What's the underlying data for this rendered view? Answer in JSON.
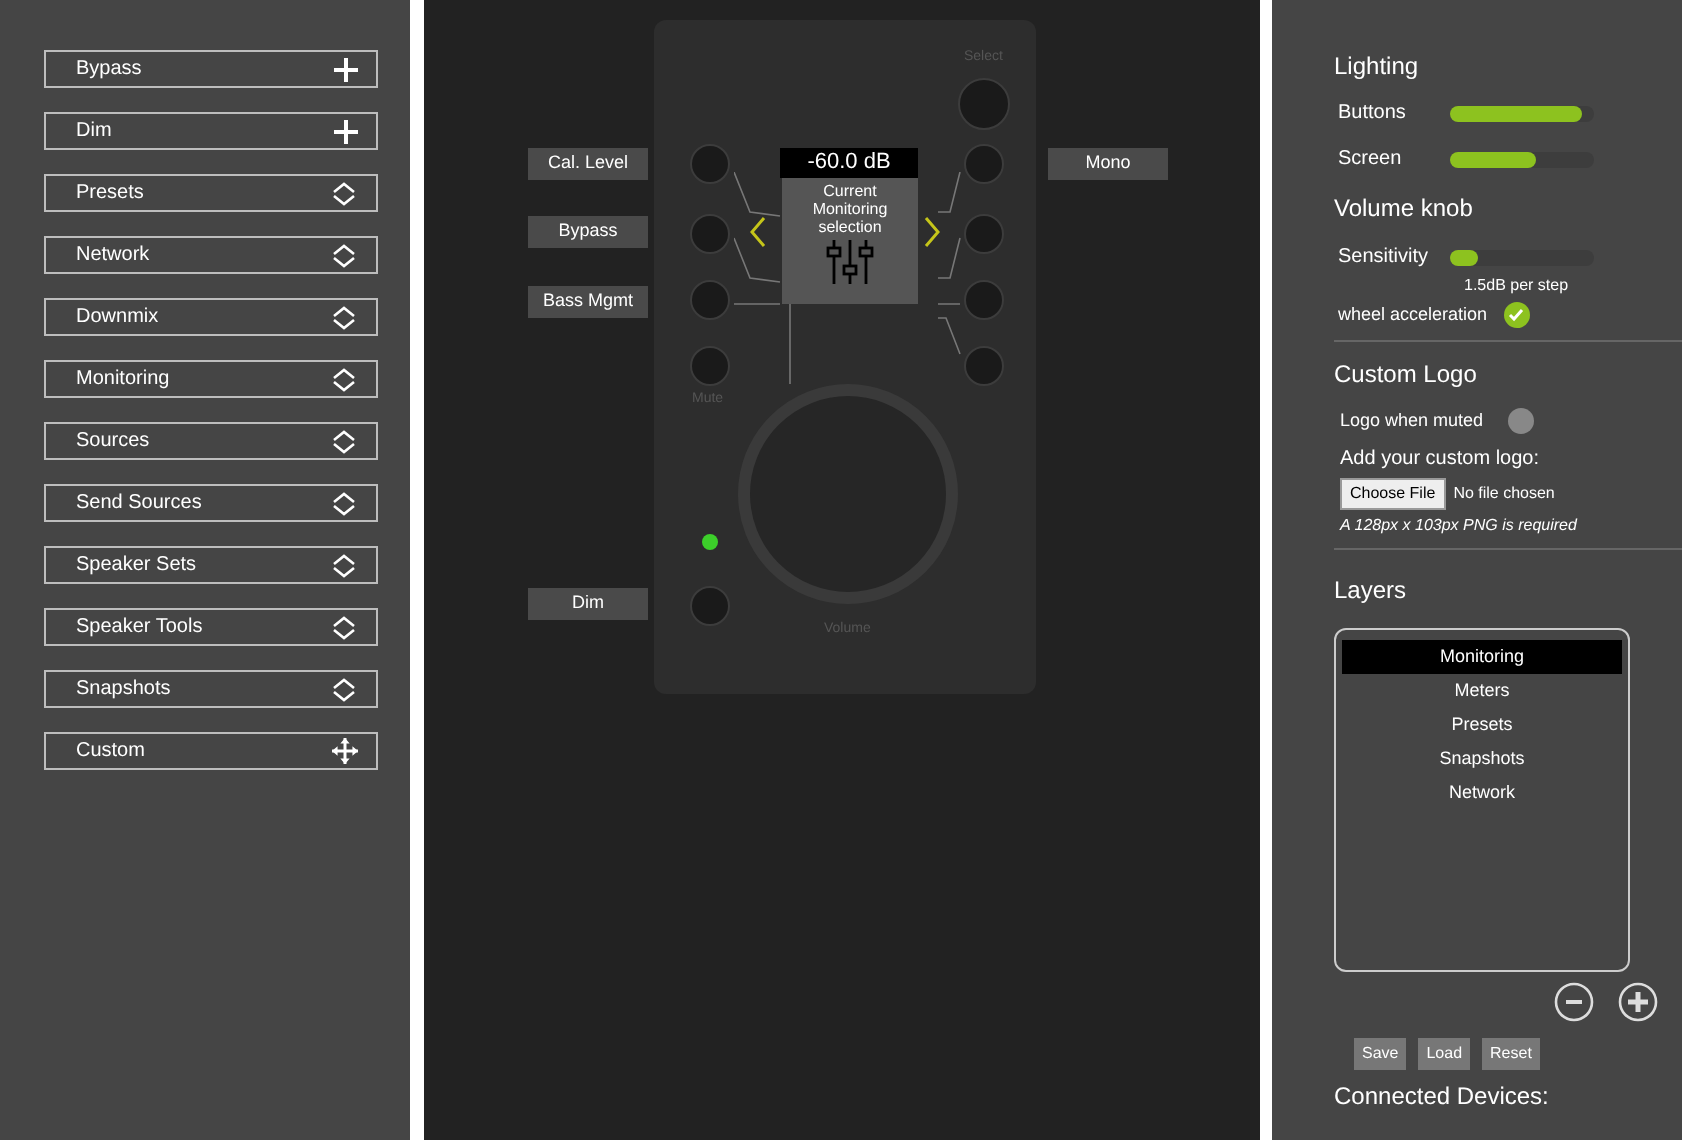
{
  "sidebar": {
    "items": [
      {
        "label": "Bypass",
        "kind": "add"
      },
      {
        "label": "Dim",
        "kind": "add"
      },
      {
        "label": "Presets",
        "kind": "expand"
      },
      {
        "label": "Network",
        "kind": "expand"
      },
      {
        "label": "Downmix",
        "kind": "expand"
      },
      {
        "label": "Monitoring",
        "kind": "expand"
      },
      {
        "label": "Sources",
        "kind": "expand"
      },
      {
        "label": "Send Sources",
        "kind": "expand"
      },
      {
        "label": "Speaker Sets",
        "kind": "expand"
      },
      {
        "label": "Speaker Tools",
        "kind": "expand"
      },
      {
        "label": "Snapshots",
        "kind": "expand"
      },
      {
        "label": "Custom",
        "kind": "move"
      }
    ]
  },
  "device": {
    "left_labels": [
      "Cal. Level",
      "Bypass",
      "Bass Mgmt"
    ],
    "dim_label": "Dim",
    "right_label": "Mono",
    "display_value": "-60.0 dB",
    "display_text": "Current Monitoring selection",
    "select_caption": "Select",
    "mute_caption": "Mute",
    "volume_caption": "Volume",
    "led_on": true
  },
  "settings": {
    "lighting": {
      "title": "Lighting",
      "sliders": [
        {
          "label": "Buttons",
          "level": 0.92
        },
        {
          "label": "Screen",
          "level": 0.6
        }
      ]
    },
    "volume_knob": {
      "title": "Volume knob",
      "sensitivity": {
        "label": "Sensitivity",
        "level": 0.2,
        "reading": "1.5dB per step"
      },
      "wheel_acceleration": {
        "label": "wheel acceleration",
        "checked": true
      }
    },
    "custom_logo": {
      "title": "Custom Logo",
      "logo_when_muted": {
        "label": "Logo when muted",
        "on": false
      },
      "upload_label": "Add your custom logo:",
      "choose_button": "Choose File",
      "file_status": "No file chosen",
      "hint": "A 128px x 103px PNG is required"
    },
    "layers": {
      "title": "Layers",
      "items": [
        {
          "label": "Monitoring",
          "selected": true
        },
        {
          "label": "Meters",
          "selected": false
        },
        {
          "label": "Presets",
          "selected": false
        },
        {
          "label": "Snapshots",
          "selected": false
        },
        {
          "label": "Network",
          "selected": false
        }
      ],
      "buttons": [
        "Save",
        "Load",
        "Reset"
      ]
    },
    "connected_devices": {
      "title": "Connected Devices:"
    }
  }
}
